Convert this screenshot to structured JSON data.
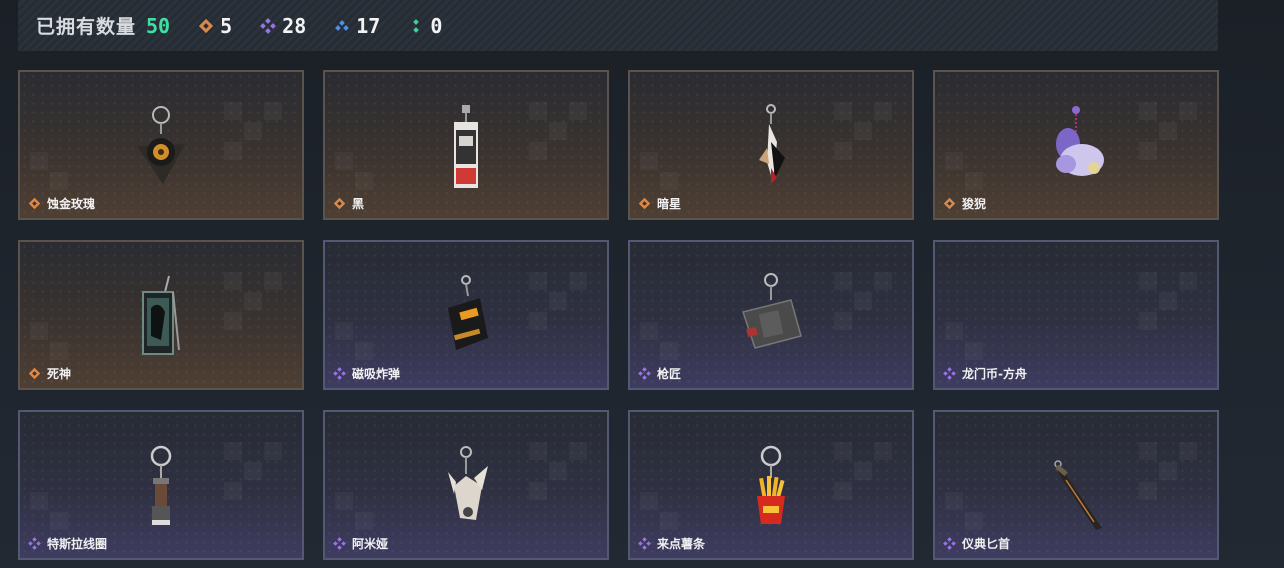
{
  "header": {
    "owned_label": "已拥有数量",
    "owned_count": "50",
    "rarities": [
      {
        "icon": "gold-rarity-icon",
        "color": "#d9894a",
        "count": "5"
      },
      {
        "icon": "purple-rarity-icon",
        "color": "#9a73e6",
        "count": "28"
      },
      {
        "icon": "blue-rarity-icon",
        "color": "#4c93e8",
        "count": "17"
      },
      {
        "icon": "green-rarity-icon",
        "color": "#3fd19a",
        "count": "0"
      }
    ]
  },
  "items": [
    {
      "name": "蚀金玫瑰",
      "rarity": "gold",
      "art": "rose-charm"
    },
    {
      "name": "黑",
      "rarity": "gold",
      "art": "black-charm"
    },
    {
      "name": "暗星",
      "rarity": "gold",
      "art": "darkstar-charm"
    },
    {
      "name": "狻猊",
      "rarity": "gold",
      "art": "lion-charm"
    },
    {
      "name": "死神",
      "rarity": "gold",
      "art": "reaper-charm"
    },
    {
      "name": "磁吸炸弹",
      "rarity": "purple",
      "art": "bomb-charm"
    },
    {
      "name": "枪匠",
      "rarity": "purple",
      "art": "gunsmith-charm"
    },
    {
      "name": "龙门币-方舟",
      "rarity": "purple",
      "art": "coin-charm"
    },
    {
      "name": "特斯拉线圈",
      "rarity": "purple",
      "art": "tesla-charm"
    },
    {
      "name": "阿米娅",
      "rarity": "purple",
      "art": "amiya-charm"
    },
    {
      "name": "来点薯条",
      "rarity": "purple",
      "art": "fries-charm"
    },
    {
      "name": "仪典匕首",
      "rarity": "purple",
      "art": "dagger-charm"
    }
  ]
}
